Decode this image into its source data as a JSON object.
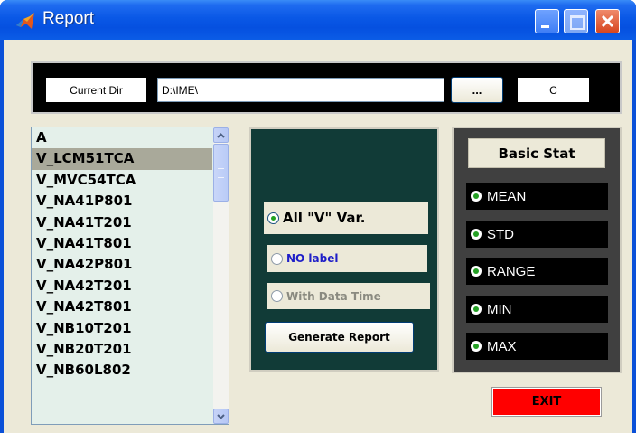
{
  "window": {
    "title": "Report"
  },
  "pathbar": {
    "dir_label": "Current Dir",
    "dir_value": "D:\\IME\\",
    "browse_label": "...",
    "drive_value": "C"
  },
  "variables": {
    "items": [
      "A",
      "V_LCM51TCA",
      "V_MVC54TCA",
      "V_NA41P801",
      "V_NA41T201",
      "V_NA41T801",
      "V_NA42P801",
      "V_NA42T201",
      "V_NA42T801",
      "V_NB10T201",
      "V_NB20T201",
      "V_NB60L802"
    ],
    "selected_index": 1
  },
  "options": {
    "all_v_var": "All \"V\" Var.",
    "no_label": "NO label",
    "with_data_time": "With Data Time",
    "generate_label": "Generate Report"
  },
  "basic_stat": {
    "header": "Basic Stat",
    "items": [
      "MEAN",
      "STD",
      "RANGE",
      "MIN",
      "MAX"
    ]
  },
  "exit_label": "EXIT",
  "colors": {
    "titlebar": "#0a58e6",
    "client_bg": "#ece9d8",
    "mid_panel": "#113b37",
    "right_panel": "#404040",
    "exit": "#ff0000",
    "list_bg": "#e4f0ea"
  }
}
